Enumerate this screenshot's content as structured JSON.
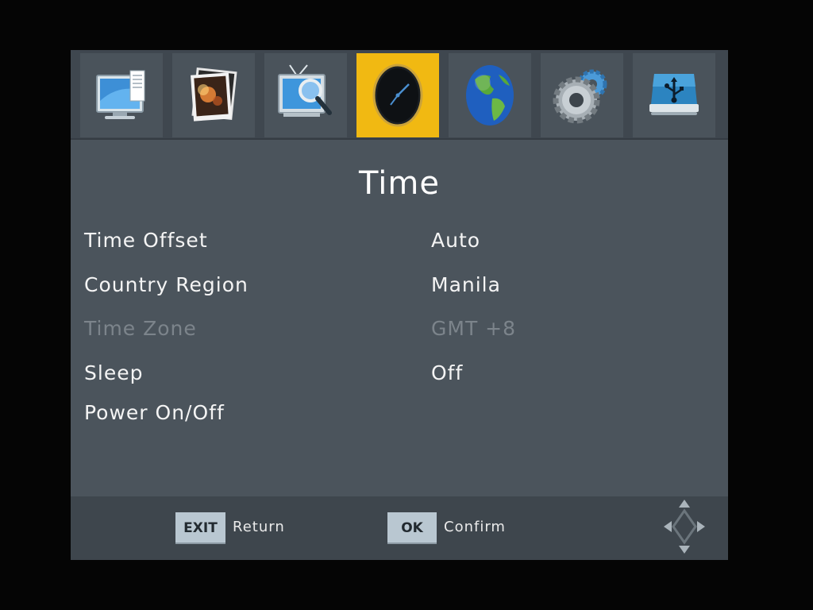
{
  "tabs": [
    {
      "name": "picture",
      "icon": "monitor-document-icon",
      "active": false
    },
    {
      "name": "photo",
      "icon": "photo-frame-icon",
      "active": false
    },
    {
      "name": "channel",
      "icon": "tv-search-icon",
      "active": false
    },
    {
      "name": "time",
      "icon": "clock-icon",
      "active": true
    },
    {
      "name": "language",
      "icon": "globe-icon",
      "active": false
    },
    {
      "name": "system",
      "icon": "gear-icon",
      "active": false
    },
    {
      "name": "usb",
      "icon": "usb-drive-icon",
      "active": false
    }
  ],
  "page": {
    "title": "Time"
  },
  "rows": [
    {
      "label": "Time Offset",
      "value": "Auto",
      "enabled": true
    },
    {
      "label": "Country Region",
      "value": "Manila",
      "enabled": true
    },
    {
      "label": "Time Zone",
      "value": "GMT +8",
      "enabled": false
    },
    {
      "label": "Sleep",
      "value": "Off",
      "enabled": true
    },
    {
      "label": "Power On/Off",
      "value": "",
      "enabled": true
    }
  ],
  "footer": {
    "exit_key": "EXIT",
    "exit_label": "Return",
    "ok_key": "OK",
    "ok_label": "Confirm"
  },
  "colors": {
    "active_tab": "#f1b912",
    "panel": "#4b545c",
    "disabled_text": "#7c848b"
  }
}
